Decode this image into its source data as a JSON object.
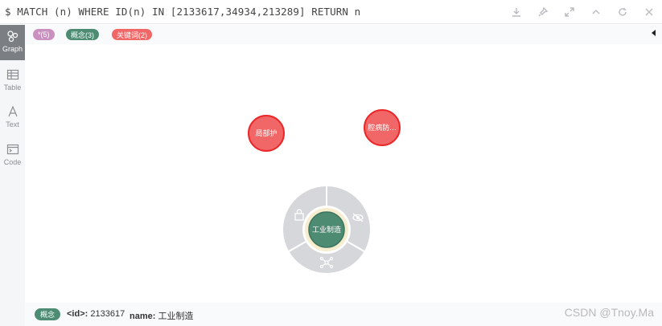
{
  "query": {
    "text": "$ MATCH (n) WHERE ID(n) IN [2133617,34934,213289] RETURN n"
  },
  "toolbar": {
    "icons": [
      "download-icon",
      "pin-icon",
      "expand-icon",
      "collapse-icon",
      "rerun-icon",
      "close-icon"
    ]
  },
  "sidebar": {
    "items": [
      {
        "label": "Graph",
        "icon": "graph-icon",
        "active": true
      },
      {
        "label": "Table",
        "icon": "table-icon",
        "active": false
      },
      {
        "label": "Text",
        "icon": "text-icon",
        "active": false
      },
      {
        "label": "Code",
        "icon": "code-icon",
        "active": false
      }
    ]
  },
  "legend": {
    "pills": [
      {
        "label": "*(5)",
        "color": "#c990c0"
      },
      {
        "label": "概念(3)",
        "color": "#4d8c73"
      },
      {
        "label": "关键词(2)",
        "color": "#f16667"
      }
    ]
  },
  "graph": {
    "nodes": [
      {
        "label": "局部护",
        "color": "#f16667",
        "border": "#eb2728"
      },
      {
        "label": "腔病防...",
        "color": "#f16667",
        "border": "#eb2728"
      },
      {
        "label": "工业制造",
        "color": "#4d8c73",
        "border": "#f5edce",
        "selected": true
      }
    ],
    "ring_menu": {
      "items": [
        "lock-icon",
        "hide-icon",
        "expand-nodes-icon"
      ]
    }
  },
  "status": {
    "pill": "概念",
    "id_label": "<id>:",
    "id_value": "2133617",
    "name_label": "name:",
    "name_value": "工业制造"
  },
  "watermark": "CSDN @Tnoy.Ma"
}
